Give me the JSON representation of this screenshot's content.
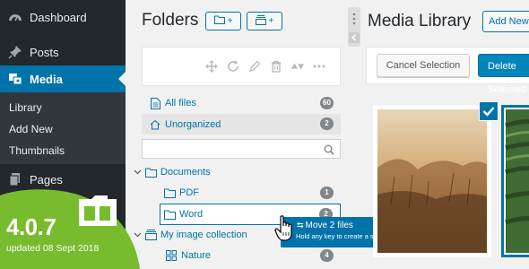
{
  "wp_menu": {
    "dashboard": "Dashboard",
    "posts": "Posts",
    "media": "Media",
    "sub_items": [
      "Library",
      "Add New",
      "Thumbnails"
    ],
    "pages": "Pages"
  },
  "folders": {
    "title": "Folders",
    "new_folder_label": "+",
    "new_category_label": "+",
    "all_files": {
      "label": "All files",
      "count": "60"
    },
    "unorganized": {
      "label": "Unorganized",
      "count": "2"
    },
    "search_placeholder": "",
    "tree": {
      "documents": {
        "label": "Documents"
      },
      "pdf": {
        "label": "PDF",
        "count": "1"
      },
      "word": {
        "label": "Word",
        "count": "2"
      },
      "collection": {
        "label": "My image collection"
      },
      "nature": {
        "label": "Nature",
        "count": "4"
      }
    }
  },
  "drag_tooltip": {
    "title": "Move 2 files",
    "hint": "Hold any key to create a shortcut"
  },
  "media": {
    "title": "Media Library",
    "add_new": "Add New",
    "cancel_selection": "Cancel Selection",
    "delete_selected": "Delete Selected"
  },
  "badge": {
    "version": "4.0.7",
    "updated": "updated 08 Sept 2018"
  },
  "colors": {
    "wp_sidebar": "#23282d",
    "accent": "#0073aa",
    "badge_green": "#78bb2e"
  }
}
